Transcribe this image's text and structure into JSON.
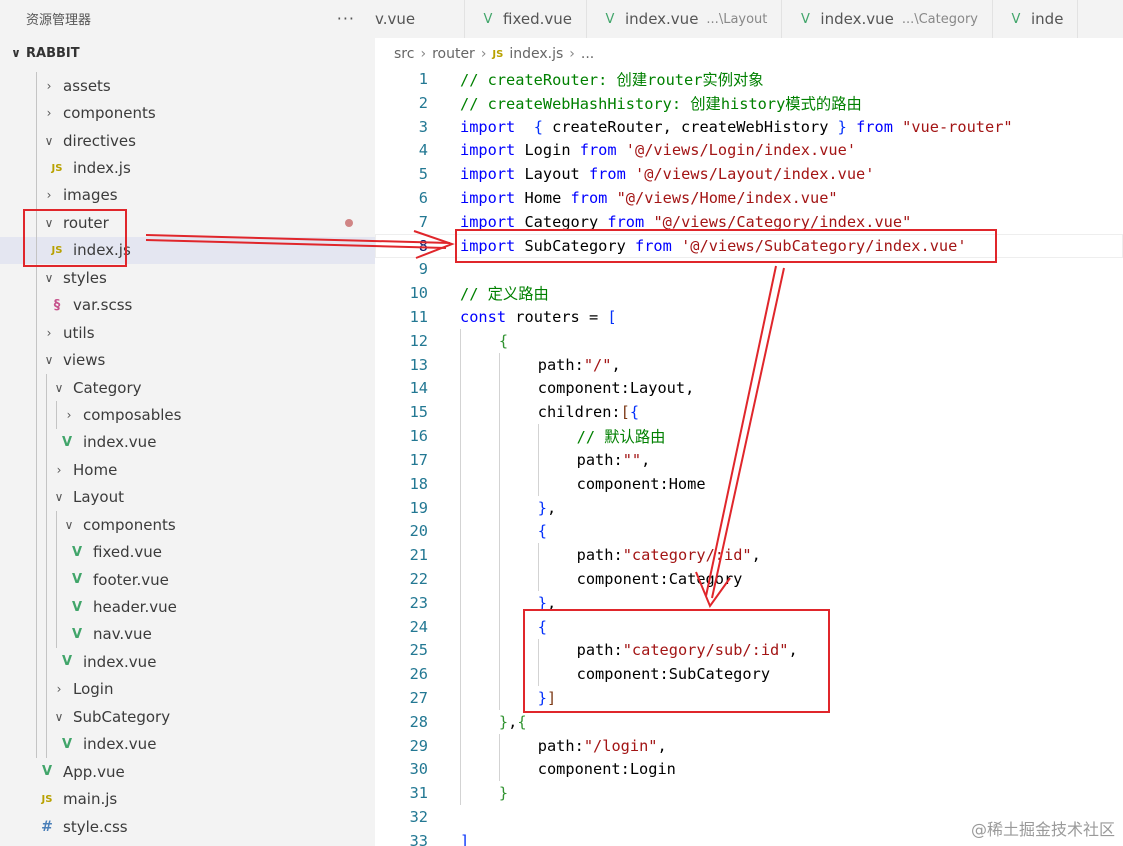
{
  "explorer": {
    "title": "资源管理器",
    "more": "···",
    "root": "RABBIT",
    "items": [
      {
        "label": "assets",
        "type": "folder",
        "depth": 1,
        "open": false
      },
      {
        "label": "components",
        "type": "folder",
        "depth": 1,
        "open": false
      },
      {
        "label": "directives",
        "type": "folder",
        "depth": 1,
        "open": true
      },
      {
        "label": "index.js",
        "type": "js",
        "depth": 1
      },
      {
        "label": "images",
        "type": "folder",
        "depth": 1,
        "open": false
      },
      {
        "label": "router",
        "type": "folder",
        "depth": 1,
        "open": true,
        "modified": true
      },
      {
        "label": "index.js",
        "type": "js",
        "depth": 1,
        "selected": true
      },
      {
        "label": "styles",
        "type": "folder",
        "depth": 1,
        "open": true
      },
      {
        "label": "var.scss",
        "type": "scss",
        "depth": 1
      },
      {
        "label": "utils",
        "type": "folder",
        "depth": 1,
        "open": false
      },
      {
        "label": "views",
        "type": "folder",
        "depth": 1,
        "open": true
      },
      {
        "label": "Category",
        "type": "folder",
        "depth": 2,
        "open": true
      },
      {
        "label": "composables",
        "type": "folder",
        "depth": 3,
        "open": false
      },
      {
        "label": "index.vue",
        "type": "vue",
        "depth": 2
      },
      {
        "label": "Home",
        "type": "folder",
        "depth": 2,
        "open": false
      },
      {
        "label": "Layout",
        "type": "folder",
        "depth": 2,
        "open": true
      },
      {
        "label": "components",
        "type": "folder",
        "depth": 3,
        "open": true
      },
      {
        "label": "fixed.vue",
        "type": "vue",
        "depth": 3
      },
      {
        "label": "footer.vue",
        "type": "vue",
        "depth": 3
      },
      {
        "label": "header.vue",
        "type": "vue",
        "depth": 3
      },
      {
        "label": "nav.vue",
        "type": "vue",
        "depth": 3
      },
      {
        "label": "index.vue",
        "type": "vue",
        "depth": 2
      },
      {
        "label": "Login",
        "type": "folder",
        "depth": 2,
        "open": false
      },
      {
        "label": "SubCategory",
        "type": "folder",
        "depth": 2,
        "open": true
      },
      {
        "label": "index.vue",
        "type": "vue",
        "depth": 2
      },
      {
        "label": "App.vue",
        "type": "vue",
        "depth": 0
      },
      {
        "label": "main.js",
        "type": "js",
        "depth": 0
      },
      {
        "label": "style.css",
        "type": "css",
        "depth": 0
      }
    ]
  },
  "tabs": [
    {
      "label": "v.vue",
      "desc": ""
    },
    {
      "label": "fixed.vue",
      "desc": ""
    },
    {
      "label": "index.vue",
      "desc": "...\\Layout"
    },
    {
      "label": "index.vue",
      "desc": "...\\Category"
    },
    {
      "label": "inde",
      "desc": ""
    }
  ],
  "breadcrumb": {
    "parts": [
      "src",
      "router"
    ],
    "file": "index.js",
    "tail": "..."
  },
  "editor": {
    "current_line": 8,
    "lines": [
      {
        "n": "1",
        "indent": 0,
        "tokens": [
          {
            "t": "// createRouter: 创建router实例对象",
            "c": "com"
          }
        ]
      },
      {
        "n": "2",
        "indent": 0,
        "tokens": [
          {
            "t": "// createWebHashHistory: 创建history模式的路由",
            "c": "com"
          }
        ]
      },
      {
        "n": "3",
        "indent": 0,
        "tokens": [
          {
            "t": "import",
            "c": "kw"
          },
          {
            "t": "  ",
            "c": "plain"
          },
          {
            "t": "{",
            "c": "brk1"
          },
          {
            "t": " createRouter, createWebHistory ",
            "c": "plain"
          },
          {
            "t": "}",
            "c": "brk1"
          },
          {
            "t": " ",
            "c": "plain"
          },
          {
            "t": "from",
            "c": "kw"
          },
          {
            "t": " ",
            "c": "plain"
          },
          {
            "t": "\"vue-router\"",
            "c": "str"
          }
        ]
      },
      {
        "n": "4",
        "indent": 0,
        "tokens": [
          {
            "t": "import",
            "c": "kw"
          },
          {
            "t": " Login ",
            "c": "plain"
          },
          {
            "t": "from",
            "c": "kw"
          },
          {
            "t": " ",
            "c": "plain"
          },
          {
            "t": "'@/views/Login/index.vue'",
            "c": "str"
          }
        ]
      },
      {
        "n": "5",
        "indent": 0,
        "tokens": [
          {
            "t": "import",
            "c": "kw"
          },
          {
            "t": " Layout ",
            "c": "plain"
          },
          {
            "t": "from",
            "c": "kw"
          },
          {
            "t": " ",
            "c": "plain"
          },
          {
            "t": "'@/views/Layout/index.vue'",
            "c": "str"
          }
        ]
      },
      {
        "n": "6",
        "indent": 0,
        "tokens": [
          {
            "t": "import",
            "c": "kw"
          },
          {
            "t": " Home ",
            "c": "plain"
          },
          {
            "t": "from",
            "c": "kw"
          },
          {
            "t": " ",
            "c": "plain"
          },
          {
            "t": "\"@/views/Home/index.vue\"",
            "c": "str"
          }
        ]
      },
      {
        "n": "7",
        "indent": 0,
        "tokens": [
          {
            "t": "import",
            "c": "kw"
          },
          {
            "t": " Category ",
            "c": "plain"
          },
          {
            "t": "from",
            "c": "kw"
          },
          {
            "t": " ",
            "c": "plain"
          },
          {
            "t": "\"@/views/Category/index.vue\"",
            "c": "str"
          }
        ]
      },
      {
        "n": "8",
        "indent": 0,
        "tokens": [
          {
            "t": "import",
            "c": "kw"
          },
          {
            "t": " SubCategory ",
            "c": "plain"
          },
          {
            "t": "from",
            "c": "kw"
          },
          {
            "t": " ",
            "c": "plain"
          },
          {
            "t": "'@/views/SubCategory/index.vue'",
            "c": "str"
          }
        ]
      },
      {
        "n": "9",
        "indent": 0,
        "tokens": []
      },
      {
        "n": "10",
        "indent": 0,
        "tokens": [
          {
            "t": "// 定义路由",
            "c": "com"
          }
        ]
      },
      {
        "n": "11",
        "indent": 0,
        "tokens": [
          {
            "t": "const",
            "c": "kw"
          },
          {
            "t": " routers = ",
            "c": "plain"
          },
          {
            "t": "[",
            "c": "brk1"
          }
        ]
      },
      {
        "n": "12",
        "indent": 1,
        "tokens": [
          {
            "t": "{",
            "c": "brk2"
          }
        ]
      },
      {
        "n": "13",
        "indent": 2,
        "tokens": [
          {
            "t": "path:",
            "c": "plain"
          },
          {
            "t": "\"/\"",
            "c": "str"
          },
          {
            "t": ",",
            "c": "plain"
          }
        ]
      },
      {
        "n": "14",
        "indent": 2,
        "tokens": [
          {
            "t": "component:Layout,",
            "c": "plain"
          }
        ]
      },
      {
        "n": "15",
        "indent": 2,
        "tokens": [
          {
            "t": "children:",
            "c": "plain"
          },
          {
            "t": "[",
            "c": "brk3"
          },
          {
            "t": "{",
            "c": "brk1"
          }
        ]
      },
      {
        "n": "16",
        "indent": 3,
        "tokens": [
          {
            "t": "// 默认路由",
            "c": "com"
          }
        ]
      },
      {
        "n": "17",
        "indent": 3,
        "tokens": [
          {
            "t": "path:",
            "c": "plain"
          },
          {
            "t": "\"\"",
            "c": "str"
          },
          {
            "t": ",",
            "c": "plain"
          }
        ]
      },
      {
        "n": "18",
        "indent": 3,
        "tokens": [
          {
            "t": "component:Home",
            "c": "plain"
          }
        ]
      },
      {
        "n": "19",
        "indent": 2,
        "tokens": [
          {
            "t": "}",
            "c": "brk1"
          },
          {
            "t": ",",
            "c": "plain"
          }
        ]
      },
      {
        "n": "20",
        "indent": 2,
        "tokens": [
          {
            "t": "{",
            "c": "brk1"
          }
        ]
      },
      {
        "n": "21",
        "indent": 3,
        "tokens": [
          {
            "t": "path:",
            "c": "plain"
          },
          {
            "t": "\"category/:id\"",
            "c": "str"
          },
          {
            "t": ",",
            "c": "plain"
          }
        ]
      },
      {
        "n": "22",
        "indent": 3,
        "tokens": [
          {
            "t": "component:Category",
            "c": "plain"
          }
        ]
      },
      {
        "n": "23",
        "indent": 2,
        "tokens": [
          {
            "t": "}",
            "c": "brk1"
          },
          {
            "t": ",",
            "c": "plain"
          }
        ]
      },
      {
        "n": "24",
        "indent": 2,
        "tokens": [
          {
            "t": "{",
            "c": "brk1"
          }
        ]
      },
      {
        "n": "25",
        "indent": 3,
        "tokens": [
          {
            "t": "path:",
            "c": "plain"
          },
          {
            "t": "\"category/sub/:id\"",
            "c": "str"
          },
          {
            "t": ",",
            "c": "plain"
          }
        ]
      },
      {
        "n": "26",
        "indent": 3,
        "tokens": [
          {
            "t": "component:SubCategory",
            "c": "plain"
          }
        ]
      },
      {
        "n": "27",
        "indent": 2,
        "tokens": [
          {
            "t": "}",
            "c": "brk1"
          },
          {
            "t": "]",
            "c": "brk3"
          }
        ]
      },
      {
        "n": "28",
        "indent": 1,
        "tokens": [
          {
            "t": "}",
            "c": "brk2"
          },
          {
            "t": ",",
            "c": "plain"
          },
          {
            "t": "{",
            "c": "brk2"
          }
        ]
      },
      {
        "n": "29",
        "indent": 2,
        "tokens": [
          {
            "t": "path:",
            "c": "plain"
          },
          {
            "t": "\"/login\"",
            "c": "str"
          },
          {
            "t": ",",
            "c": "plain"
          }
        ]
      },
      {
        "n": "30",
        "indent": 2,
        "tokens": [
          {
            "t": "component:Login",
            "c": "plain"
          }
        ]
      },
      {
        "n": "31",
        "indent": 1,
        "tokens": [
          {
            "t": "}",
            "c": "brk2"
          }
        ]
      },
      {
        "n": "32",
        "indent": 0,
        "tokens": []
      },
      {
        "n": "33",
        "indent": 0,
        "tokens": [
          {
            "t": "]",
            "c": "brk1"
          }
        ]
      }
    ]
  },
  "annotation_color": "#e0262b",
  "watermark": "@稀土掘金技术社区"
}
